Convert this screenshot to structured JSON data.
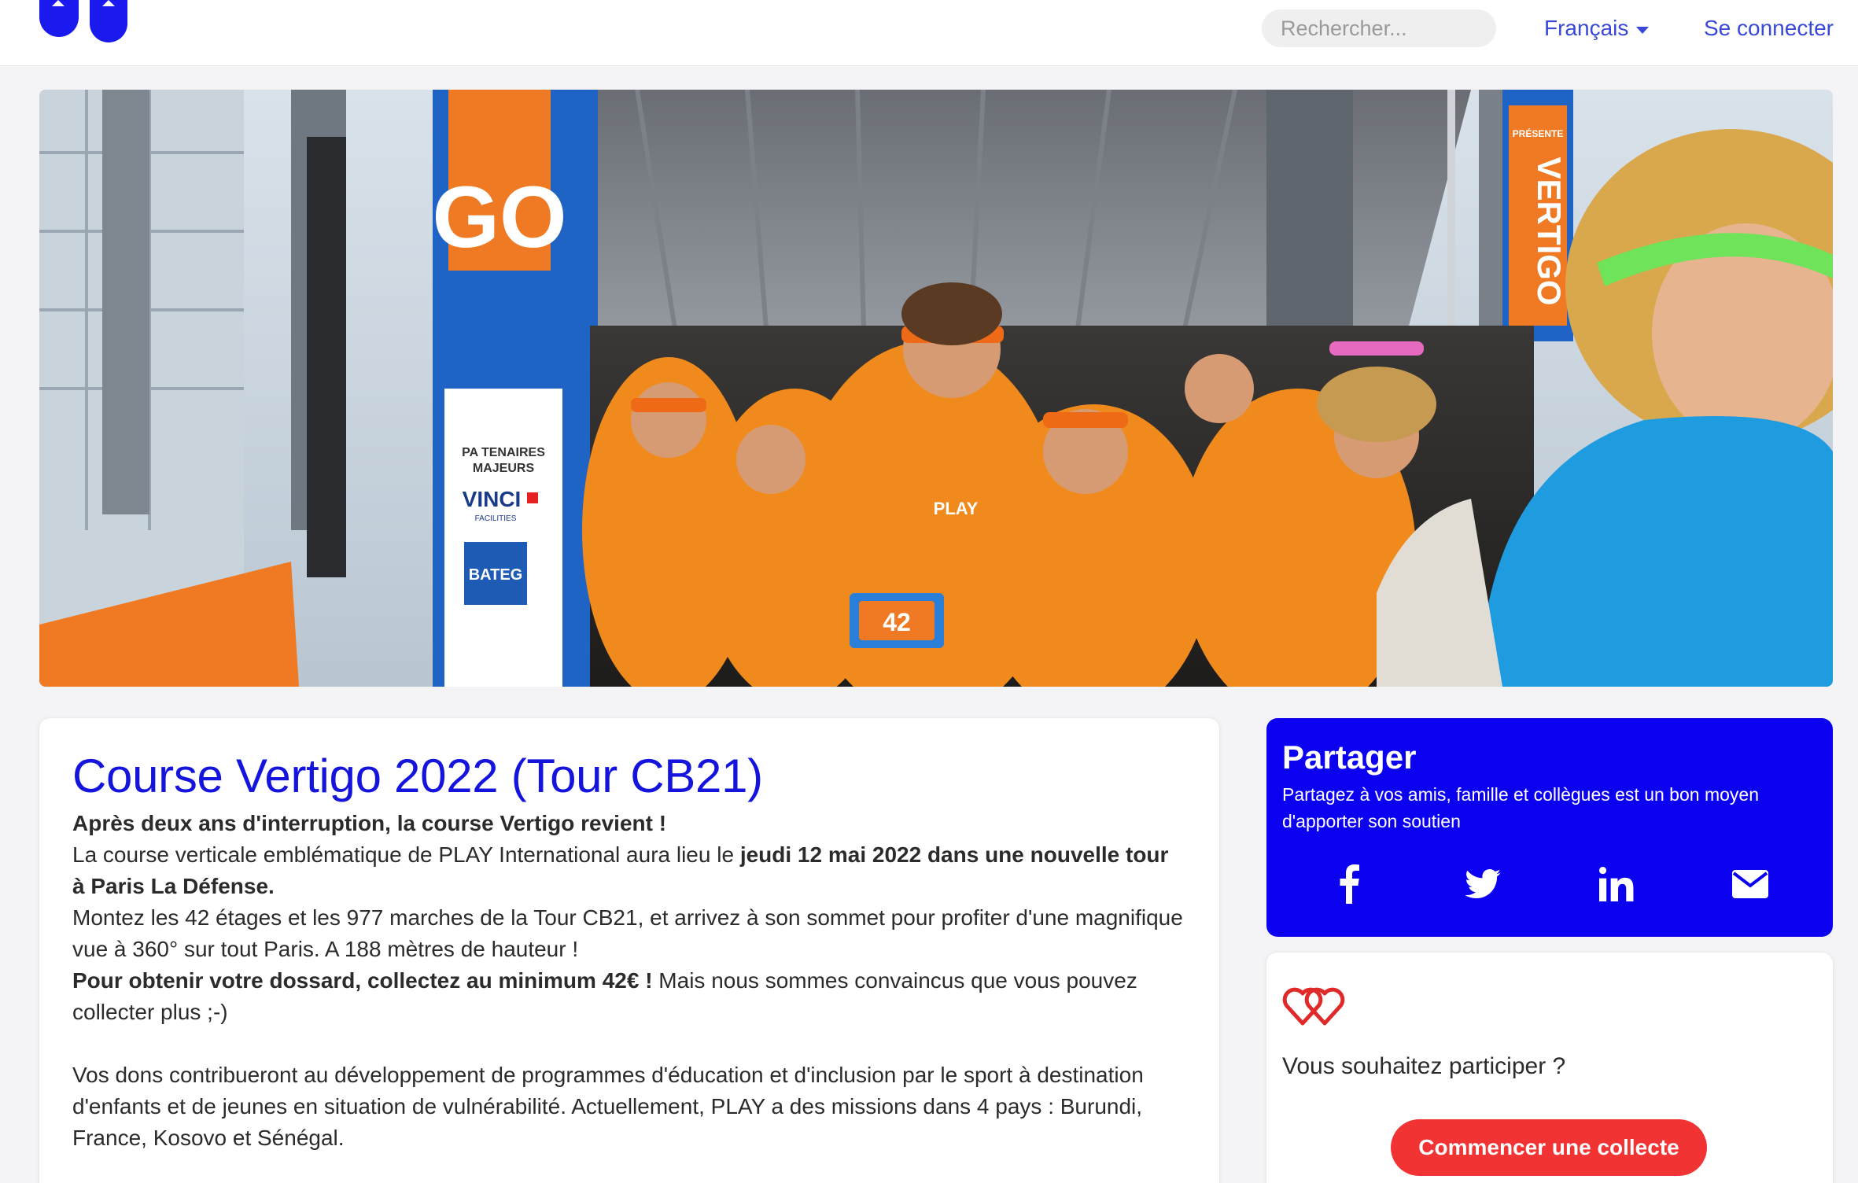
{
  "header": {
    "search_placeholder": "Rechercher...",
    "language_label": "Français",
    "login_label": "Se connecter"
  },
  "hero": {
    "bib_number": "42",
    "banner_left_text": "GO",
    "banner_right_text": "VERTIGO",
    "banner_right_top": "PRÉSENTE",
    "partners_heading_1": "PA TENAIRES",
    "partners_heading_2": "MAJEURS",
    "partner_1": "VINCI",
    "partner_1_sub": "FACILITIES",
    "partner_2": "BATEG",
    "shirt_text": "PLAY"
  },
  "event": {
    "title": "Course Vertigo 2022 (Tour CB21)",
    "intro": "Après deux ans d'interruption, la course Vertigo revient !",
    "line2_pre": "La course verticale emblématique de PLAY International aura lieu le ",
    "line2_bold": "jeudi 12 mai 2022 dans une nouvelle tour à Paris La Défense.",
    "line3": "Montez les 42 étages et les 977 marches de la Tour CB21, et arrivez à son sommet pour profiter d'une magnifique vue à 360° sur tout Paris. A 188 mètres de hauteur !",
    "line4_bold": "Pour obtenir votre dossard, collectez au minimum 42€ !",
    "line4_rest": " Mais nous sommes convaincus que vous pouvez collecter plus ;-)",
    "line5": "Vos dons contribueront au développement de programmes d'éducation et d'inclusion par le sport à destination d'enfants et de jeunes en situation de vulnérabilité. Actuellement, PLAY a des missions dans 4 pays : Burundi, France, Kosovo et Sénégal."
  },
  "share": {
    "title": "Partager",
    "subtitle": "Partagez à vos amis, famille et collègues est un bon moyen d'apporter son soutien",
    "icons": [
      "facebook-icon",
      "twitter-icon",
      "linkedin-icon",
      "email-icon"
    ]
  },
  "participate": {
    "question": "Vous souhaitez participer ?",
    "button_label": "Commencer une collecte"
  },
  "colors": {
    "brand_blue": "#0c00f0",
    "link_blue": "#3a48d8",
    "title_blue": "#1414dc",
    "cta_red": "#f23333",
    "shirt_orange": "#f08a1c"
  }
}
